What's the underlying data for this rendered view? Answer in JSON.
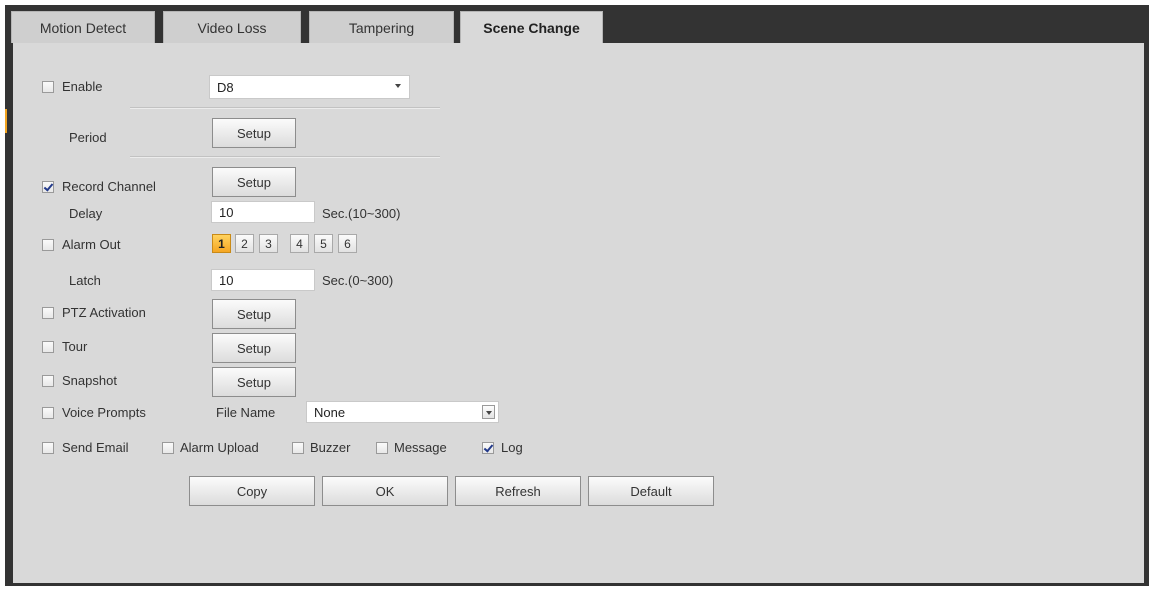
{
  "tabs": [
    {
      "label": "Motion Detect"
    },
    {
      "label": "Video Loss"
    },
    {
      "label": "Tampering"
    },
    {
      "label": "Scene Change"
    }
  ],
  "active_tab": "Scene Change",
  "form": {
    "enable_label": "Enable",
    "enable_checked": false,
    "channel_value": "D8",
    "period_label": "Period",
    "setup_label": "Setup",
    "record_channel_label": "Record Channel",
    "record_channel_checked": true,
    "delay_label": "Delay",
    "delay_value": "10",
    "delay_range": "Sec.(10~300)",
    "alarm_out_label": "Alarm Out",
    "alarm_out_checked": false,
    "alarm_outputs": [
      "1",
      "2",
      "3",
      "4",
      "5",
      "6"
    ],
    "alarm_output_selected": "1",
    "latch_label": "Latch",
    "latch_value": "10",
    "latch_range": "Sec.(0~300)",
    "ptz_label": "PTZ Activation",
    "tour_label": "Tour",
    "snapshot_label": "Snapshot",
    "voice_label": "Voice Prompts",
    "file_name_label": "File Name",
    "file_name_value": "None",
    "send_email_label": "Send Email",
    "alarm_upload_label": "Alarm Upload",
    "buzzer_label": "Buzzer",
    "message_label": "Message",
    "log_label": "Log",
    "log_checked": true
  },
  "buttons": {
    "copy": "Copy",
    "ok": "OK",
    "refresh": "Refresh",
    "default": "Default"
  },
  "colors": {
    "accent": "#f5a623",
    "panel_bg": "#d9d9d9",
    "frame": "#333333"
  }
}
